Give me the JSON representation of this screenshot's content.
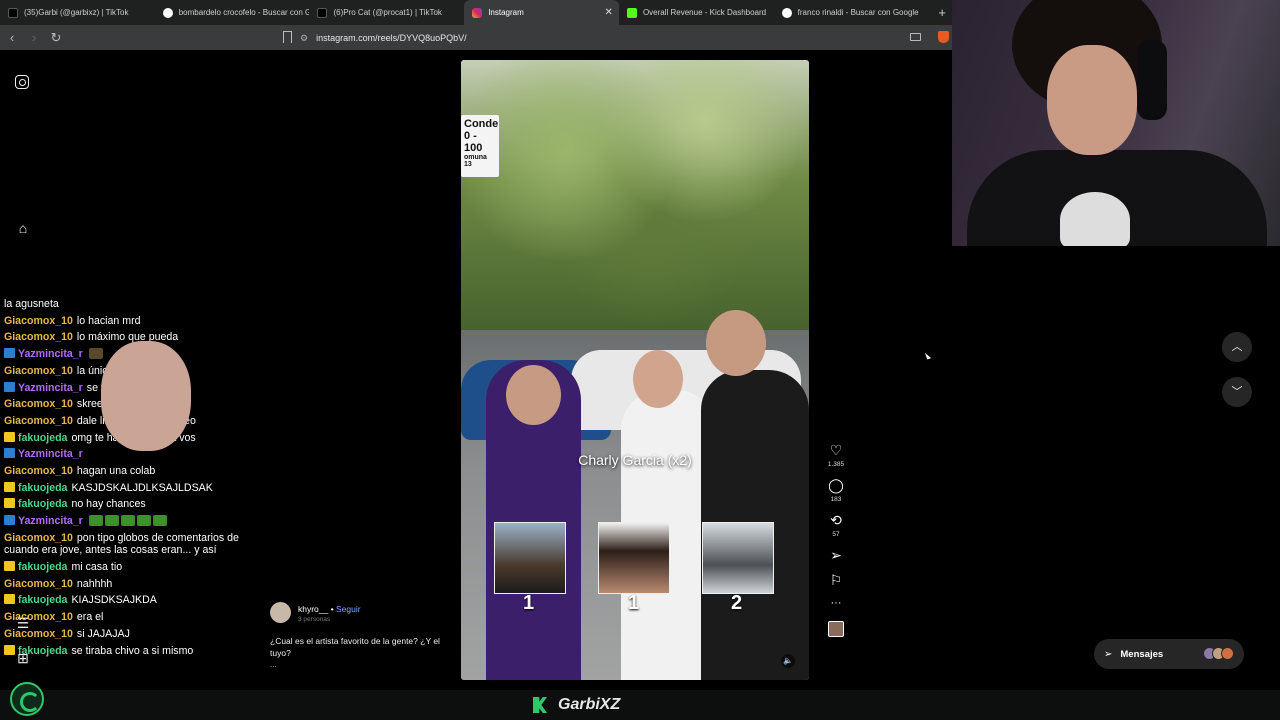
{
  "browser": {
    "tabs": [
      {
        "label": "(35)Garbi (@garbixz) | TikTok",
        "icon": "tiktok-icon"
      },
      {
        "label": "bombardelo crocofelo - Buscar con Go",
        "icon": "google-icon"
      },
      {
        "label": "(6)Pro Cat (@procat1) | TikTok",
        "icon": "tiktok-icon"
      },
      {
        "label": "Instagram",
        "icon": "instagram-icon",
        "active": true
      },
      {
        "label": "Overall Revenue - Kick Dashboard",
        "icon": "kick-icon"
      },
      {
        "label": "franco rinaldi - Buscar con Google",
        "icon": "google-icon"
      }
    ],
    "url": "instagram.com/reels/DYVQ8uoPQbV/"
  },
  "chat": [
    {
      "user": "",
      "text": "la agusneta",
      "color": "#ffffff",
      "badge": ""
    },
    {
      "user": "Giacomox_10",
      "text": "lo hacian mrd",
      "color": "#e6b84a",
      "badge": ""
    },
    {
      "user": "Giacomox_10",
      "text": "lo máximo que pueda",
      "color": "#e6b84a",
      "badge": ""
    },
    {
      "user": "Yazmincita_r",
      "text": "",
      "color": "#b36bff",
      "badge": "sword",
      "emote": "dark"
    },
    {
      "user": "Giacomox_10",
      "text": "la única real",
      "color": "#e6b84a",
      "badge": ""
    },
    {
      "user": "Yazmincita_r",
      "text": "se vienen cositaas",
      "color": "#b36bff",
      "badge": "sword"
    },
    {
      "user": "Giacomox_10",
      "text": "skreee",
      "color": "#e6b84a",
      "badge": ""
    },
    {
      "user": "Giacomox_10",
      "text": "dale like y comenta video",
      "color": "#e6b84a",
      "badge": ""
    },
    {
      "user": "fakuojeda",
      "text": "omg te habla directo a vos",
      "color": "#4fd58a",
      "badge": "crown"
    },
    {
      "user": "Yazmincita_r",
      "text": "",
      "color": "#b36bff",
      "badge": "sword",
      "emote": "face"
    },
    {
      "user": "Giacomox_10",
      "text": "hagan una colab",
      "color": "#e6b84a",
      "badge": ""
    },
    {
      "user": "fakuojeda",
      "text": "KASJDSKALJDLKSAJLDSAK",
      "color": "#4fd58a",
      "badge": "crown"
    },
    {
      "user": "fakuojeda",
      "text": "no hay chances",
      "color": "#4fd58a",
      "badge": "crown"
    },
    {
      "user": "Yazmincita_r",
      "text": "",
      "color": "#b36bff",
      "badge": "sword",
      "emote": "frog5"
    },
    {
      "user": "Giacomox_10",
      "text": "pon tipo globos de comentarios de cuando era jove, antes las cosas eran... y así",
      "color": "#e6b84a",
      "badge": "",
      "wrap": true
    },
    {
      "user": "fakuojeda",
      "text": "mi casa tio",
      "color": "#4fd58a",
      "badge": "crown"
    },
    {
      "user": "Giacomox_10",
      "text": "nahhhh",
      "color": "#e6b84a",
      "badge": ""
    },
    {
      "user": "fakuojeda",
      "text": "KIAJSDKSAJKDA",
      "color": "#4fd58a",
      "badge": "crown"
    },
    {
      "user": "Giacomox_10",
      "text": "era el",
      "color": "#e6b84a",
      "badge": ""
    },
    {
      "user": "Giacomox_10",
      "text": "si JAJAJAJ",
      "color": "#e6b84a",
      "badge": ""
    },
    {
      "user": "fakuojeda",
      "text": "se tiraba chivo a si mismo",
      "color": "#4fd58a",
      "badge": "crown"
    }
  ],
  "reel": {
    "sign_line1": "Conde",
    "sign_line2": "0 - 100",
    "sign_line3": "omuna 13",
    "caption": "Charly Garcia (x2)",
    "numbers": [
      "1",
      "1",
      "2"
    ],
    "likes": "1.385",
    "comments": "183",
    "reposts": "57"
  },
  "post": {
    "username": "khyro__",
    "follow": "Seguir",
    "subtitle": "3 personas",
    "caption": "¿Cual es el artista favorito de la gente? ¿Y el tuyo?",
    "more": "..."
  },
  "messages_label": "Mensajes",
  "stream": {
    "name": "GarbiXZ",
    "accent": "#2ec86a"
  }
}
